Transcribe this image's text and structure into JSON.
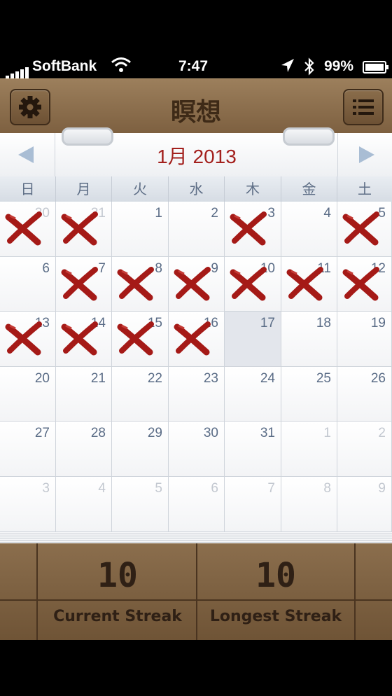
{
  "status": {
    "carrier": "SoftBank",
    "time": "7:47",
    "battery": "99%"
  },
  "header": {
    "title": "瞑想",
    "settings_icon": "gear-icon",
    "list_icon": "list-icon"
  },
  "calendar": {
    "month_label": "1月 2013",
    "weekdays": [
      "日",
      "月",
      "火",
      "水",
      "木",
      "金",
      "土"
    ],
    "weeks": [
      [
        {
          "d": "30",
          "o": true,
          "x": true
        },
        {
          "d": "31",
          "o": true,
          "x": true
        },
        {
          "d": "1",
          "o": false,
          "x": false
        },
        {
          "d": "2",
          "o": false,
          "x": false
        },
        {
          "d": "3",
          "o": false,
          "x": true
        },
        {
          "d": "4",
          "o": false,
          "x": false
        },
        {
          "d": "5",
          "o": false,
          "x": true
        }
      ],
      [
        {
          "d": "6",
          "o": false,
          "x": false
        },
        {
          "d": "7",
          "o": false,
          "x": true
        },
        {
          "d": "8",
          "o": false,
          "x": true
        },
        {
          "d": "9",
          "o": false,
          "x": true
        },
        {
          "d": "10",
          "o": false,
          "x": true
        },
        {
          "d": "11",
          "o": false,
          "x": true
        },
        {
          "d": "12",
          "o": false,
          "x": true
        }
      ],
      [
        {
          "d": "13",
          "o": false,
          "x": true
        },
        {
          "d": "14",
          "o": false,
          "x": true
        },
        {
          "d": "15",
          "o": false,
          "x": true
        },
        {
          "d": "16",
          "o": false,
          "x": true
        },
        {
          "d": "17",
          "o": false,
          "x": false,
          "today": true
        },
        {
          "d": "18",
          "o": false,
          "x": false
        },
        {
          "d": "19",
          "o": false,
          "x": false
        }
      ],
      [
        {
          "d": "20",
          "o": false,
          "x": false
        },
        {
          "d": "21",
          "o": false,
          "x": false
        },
        {
          "d": "22",
          "o": false,
          "x": false
        },
        {
          "d": "23",
          "o": false,
          "x": false
        },
        {
          "d": "24",
          "o": false,
          "x": false
        },
        {
          "d": "25",
          "o": false,
          "x": false
        },
        {
          "d": "26",
          "o": false,
          "x": false
        }
      ],
      [
        {
          "d": "27",
          "o": false,
          "x": false
        },
        {
          "d": "28",
          "o": false,
          "x": false
        },
        {
          "d": "29",
          "o": false,
          "x": false
        },
        {
          "d": "30",
          "o": false,
          "x": false
        },
        {
          "d": "31",
          "o": false,
          "x": false
        },
        {
          "d": "1",
          "o": true,
          "x": false
        },
        {
          "d": "2",
          "o": true,
          "x": false
        }
      ],
      [
        {
          "d": "3",
          "o": true,
          "x": false
        },
        {
          "d": "4",
          "o": true,
          "x": false
        },
        {
          "d": "5",
          "o": true,
          "x": false
        },
        {
          "d": "6",
          "o": true,
          "x": false
        },
        {
          "d": "7",
          "o": true,
          "x": false
        },
        {
          "d": "8",
          "o": true,
          "x": false
        },
        {
          "d": "9",
          "o": true,
          "x": false
        }
      ]
    ]
  },
  "stats": {
    "current_value": "10",
    "current_label": "Current Streak",
    "longest_value": "10",
    "longest_label": "Longest Streak"
  },
  "colors": {
    "accent_red": "#a3201d",
    "wood": "#7d6040"
  }
}
